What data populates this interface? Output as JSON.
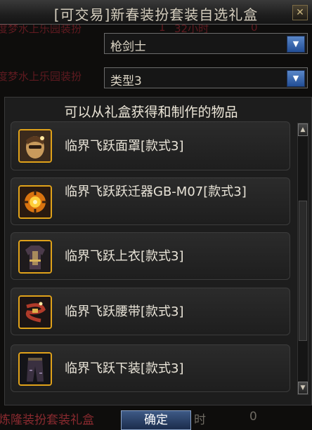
{
  "window": {
    "title": "[可交易]新春装扮套装自选礼盒",
    "close_glyph": "✕"
  },
  "background_rows": [
    {
      "text": "度梦水上乐园装扮",
      "col2": "1",
      "col3": "32小时",
      "col4": "0"
    },
    {
      "text": "度梦水上乐园装扮"
    }
  ],
  "dropdown_class": {
    "value": "枪剑士"
  },
  "dropdown_type": {
    "value": "类型3"
  },
  "panel": {
    "header": "可以从礼盒获得和制作的物品",
    "items": [
      {
        "name": "临界飞跃面罩[款式3]",
        "icon": "mask-icon"
      },
      {
        "name": "临界飞跃跃迁器GB-M07[款式3]",
        "icon": "jump-device-icon"
      },
      {
        "name": "临界飞跃上衣[款式3]",
        "icon": "top-icon"
      },
      {
        "name": "临界飞跃腰带[款式3]",
        "icon": "belt-icon"
      },
      {
        "name": "临界飞跃下装[款式3]",
        "icon": "pants-icon"
      }
    ]
  },
  "footer": {
    "left_text": "炼隆装扮套装礼盒",
    "confirm_label": "确定",
    "hours_text": "时",
    "count_text": "0"
  },
  "colors": {
    "icon_border": "#e0a21a",
    "accent_blue": "#3e5a86"
  }
}
